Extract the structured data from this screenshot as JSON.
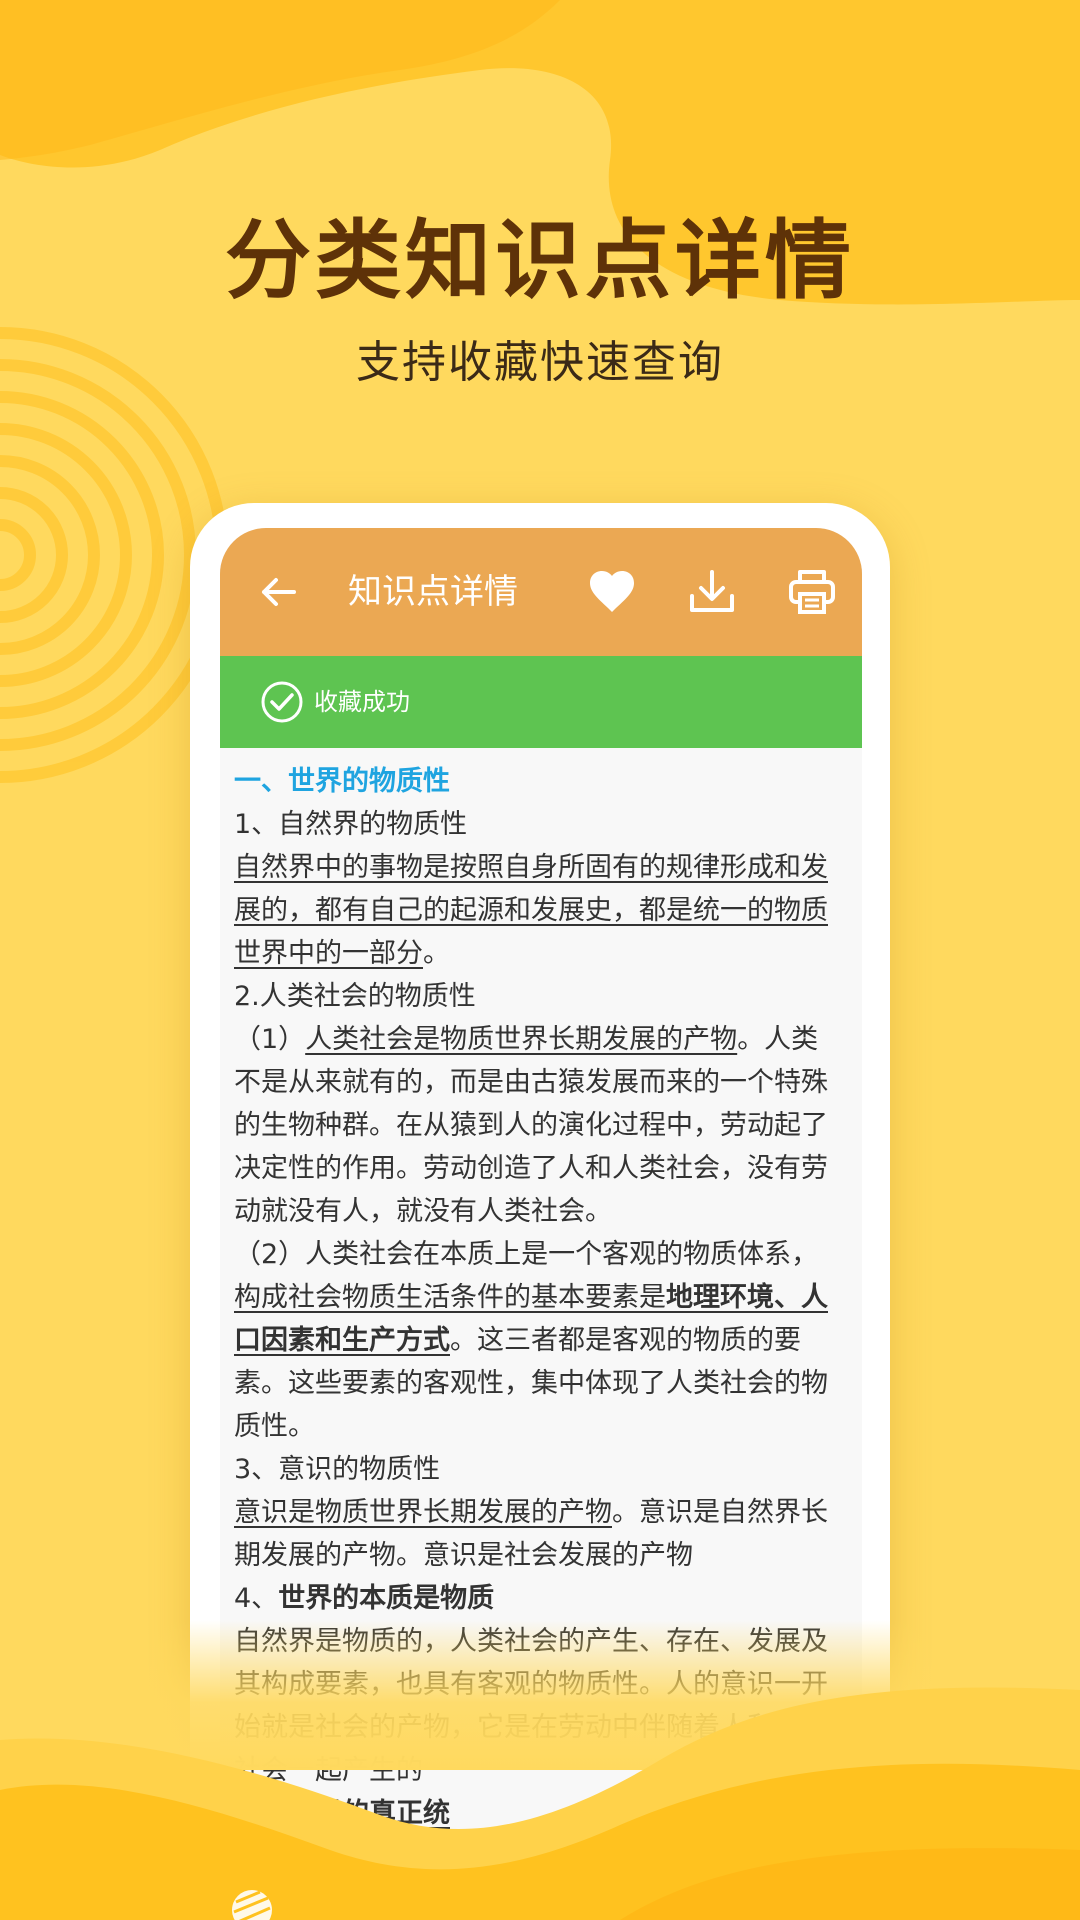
{
  "promo": {
    "headline": "分类知识点详情",
    "subline": "支持收藏快速查询"
  },
  "appbar": {
    "title": "知识点详情",
    "back_icon": "arrow-left-icon",
    "favorite_icon": "heart-icon",
    "download_icon": "download-icon",
    "print_icon": "printer-icon"
  },
  "toast": {
    "icon": "check-circle-icon",
    "message": "收藏成功"
  },
  "article": {
    "section_title": "一、世界的物质性",
    "p1_title": "1、自然界的物质性",
    "p1_body": "自然界中的事物是按照自身所固有的规律形成和发展的，都有自己的起源和发展史，都是统一的物质世界中的一部分",
    "p1_end": "。",
    "p2_title": "2.人类社会的物质性",
    "p3_prefix": "（1）",
    "p3_underline": "人类社会是物质世界长期发展的产物",
    "p3_rest": "。人类不是从来就有的，而是由古猿发展而来的一个特殊的生物种群。在从猿到人的演化过程中，劳动起了决定性的作用。劳动创造了人和人类社会，没有劳动就没有人，就没有人类社会。",
    "p4_prefix": "（2）人类社会在本质上是一个客观的物质体系，",
    "p4_underline": "构成社会物质生活条件的基本要素是",
    "p4_bold": "地理环境、人口因素和生产方式",
    "p4_rest": "。这三者都是客观的物质的要素。这些要素的客观性，集中体现了人类社会的物质性。",
    "p5_title": "3、意识的物质性",
    "p5_underline": "意识是物质世界长期发展的产物",
    "p5_rest": "。意识是自然界长期发展的产物。意识是社会发展的产物",
    "p6_prefix": "4、",
    "p6_bold": "世界的本质是物质",
    "p7_body": "自然界是物质的，人类社会的产生、存在、发展及其构成要素，也具有客观的物质性。人的意识一开始就是社会的产物，它是在劳动中伴随着人和人类社会一起产生的",
    "p8_partial": "界、世界的真正统"
  },
  "colors": {
    "background": "#FFD95E",
    "appbar": "#EBA853",
    "toast": "#5EC451",
    "section_title": "#1FA4E0",
    "headline": "#5E3208"
  }
}
